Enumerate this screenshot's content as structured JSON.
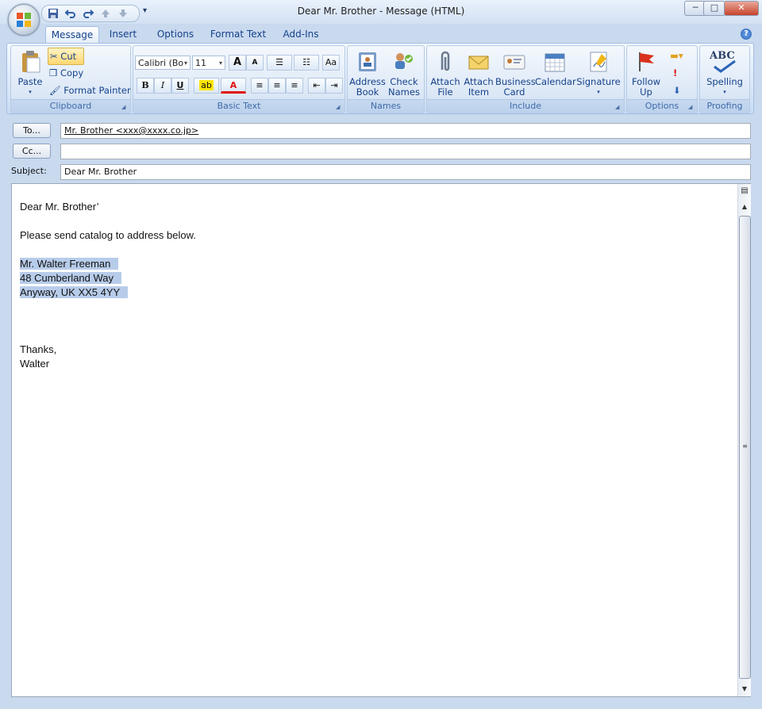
{
  "window": {
    "title": "Dear Mr. Brother - Message (HTML)",
    "minimize_glyph": "─",
    "maximize_glyph": "□",
    "close_glyph": "✕"
  },
  "quick_access": {
    "icons": [
      "save-icon",
      "undo-icon",
      "redo-icon",
      "up-arrow-icon",
      "down-arrow-icon"
    ],
    "more_glyph": "▾"
  },
  "tabs": [
    "Message",
    "Insert",
    "Options",
    "Format Text",
    "Add-Ins"
  ],
  "help_glyph": "?",
  "ribbon": {
    "clipboard": {
      "label": "Clipboard",
      "paste": "Paste",
      "cut": "Cut",
      "copy": "Copy",
      "format_painter": "Format Painter"
    },
    "basic_text": {
      "label": "Basic Text",
      "font_name": "Calibri (Bo",
      "font_size": "11",
      "grow_font": "A",
      "shrink_font": "A",
      "bold": "B",
      "italic": "I",
      "underline": "U",
      "font_color_glyph": "A"
    },
    "names": {
      "label": "Names",
      "address_book_l1": "Address",
      "address_book_l2": "Book",
      "check_names_l1": "Check",
      "check_names_l2": "Names"
    },
    "include": {
      "label": "Include",
      "attach_file_l1": "Attach",
      "attach_file_l2": "File",
      "attach_item_l1": "Attach",
      "attach_item_l2": "Item",
      "business_card_l1": "Business",
      "business_card_l2": "Card",
      "calendar": "Calendar",
      "signature": "Signature"
    },
    "options": {
      "label": "Options",
      "follow_up_l1": "Follow",
      "follow_up_l2": "Up"
    },
    "proofing": {
      "label": "Proofing",
      "spelling": "Spelling",
      "abc": "ABC"
    }
  },
  "header": {
    "to_button": "To...",
    "to_value": "Mr. Brother <xxx@xxxx.co.jp>",
    "cc_button": "Cc...",
    "cc_value": "",
    "subject_label": "Subject:",
    "subject_value": "Dear Mr. Brother"
  },
  "body": {
    "greeting": "Dear Mr. Brother’",
    "line1": "Please send catalog to address below.",
    "address1": "Mr. Walter Freeman",
    "address2": "48 Cumberland Way",
    "address3": "Anyway, UK XX5 4YY",
    "closing": "Thanks,",
    "signature": "Walter"
  },
  "colors": {
    "accent": "#15428b",
    "selection": "#b7ccea",
    "highlight_yellow": "#ffd772",
    "font_color_red": "#e01010"
  }
}
